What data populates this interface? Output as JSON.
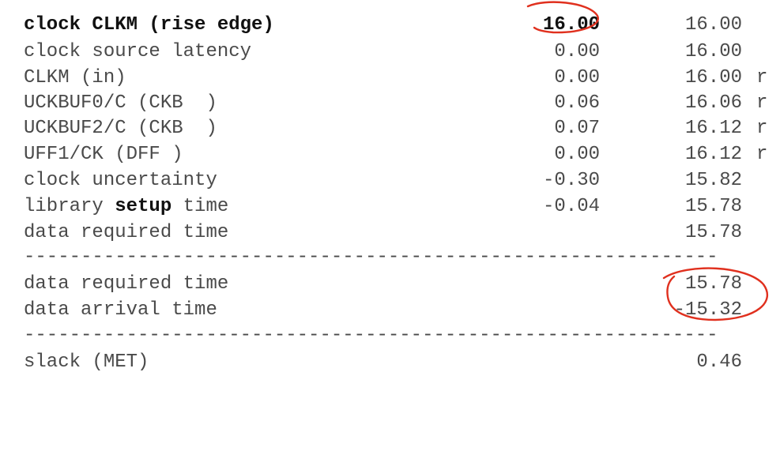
{
  "report": {
    "rows": [
      {
        "desc": "clock CLKM (rise edge)",
        "incr": "16.00",
        "path": "16.00",
        "flag": "",
        "bold": true
      },
      {
        "desc": "clock source latency",
        "incr": "0.00",
        "path": "16.00",
        "flag": ""
      },
      {
        "desc": "CLKM (in)",
        "incr": "0.00",
        "path": "16.00",
        "flag": "r"
      },
      {
        "desc": "UCKBUF0/C (CKB  )",
        "incr": "0.06",
        "path": "16.06",
        "flag": "r"
      },
      {
        "desc": "UCKBUF2/C (CKB  )",
        "incr": "0.07",
        "path": "16.12",
        "flag": "r"
      },
      {
        "desc": "UFF1/CK (DFF )",
        "incr": "0.00",
        "path": "16.12",
        "flag": "r"
      },
      {
        "desc": "clock uncertainty",
        "incr": "-0.30",
        "path": "15.82",
        "flag": ""
      },
      {
        "desc_pre": "library ",
        "desc_bold": "setup",
        "desc_post": " time",
        "incr": "-0.04",
        "path": "15.78",
        "flag": ""
      },
      {
        "desc": "data required time",
        "incr": "",
        "path": "15.78",
        "flag": ""
      }
    ],
    "separator": "-------------------------------------------------------------",
    "summary": [
      {
        "desc": "data required time",
        "path": "15.78"
      },
      {
        "desc": "data arrival time",
        "path": "-15.32"
      }
    ],
    "slack": {
      "desc": "slack (MET)",
      "path": "0.46"
    }
  },
  "annotation_color": "#e0301e"
}
